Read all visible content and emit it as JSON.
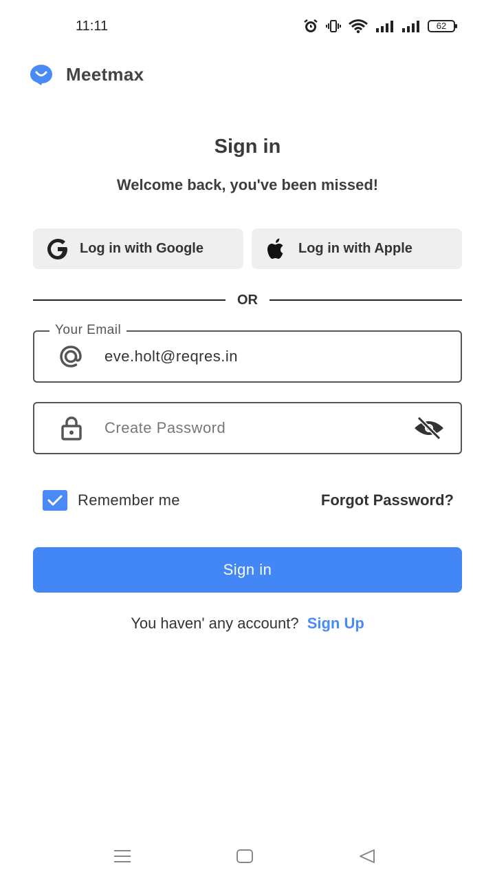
{
  "status_bar": {
    "time": "11:11",
    "battery": "62",
    "icons": [
      "alarm-icon",
      "vibrate-icon",
      "wifi-icon",
      "signal-icon",
      "signal-icon",
      "battery-icon"
    ]
  },
  "brand": {
    "name": "Meetmax",
    "logo_icon": "chat-smile-icon",
    "color": "#4a8af4"
  },
  "header": {
    "title": "Sign in",
    "subtitle": "Welcome back, you've been missed!"
  },
  "social": {
    "google_label": "Log in with Google",
    "apple_label": "Log in with Apple"
  },
  "divider": {
    "text": "OR"
  },
  "email": {
    "label": "Your Email",
    "value": "eve.holt@reqres.in",
    "icon": "at-icon"
  },
  "password": {
    "placeholder": "Create Password",
    "icon": "lock-icon",
    "toggle_icon": "eye-off-icon"
  },
  "options": {
    "remember_label": "Remember me",
    "remember_checked": true,
    "forgot_label": "Forgot Password?"
  },
  "submit": {
    "label": "Sign in",
    "color": "#4287f5"
  },
  "footer": {
    "prompt": "You haven' any account?",
    "signup_label": "Sign Up"
  },
  "nav_bar": {
    "icons": [
      "menu-icon",
      "home-icon",
      "back-icon"
    ]
  }
}
